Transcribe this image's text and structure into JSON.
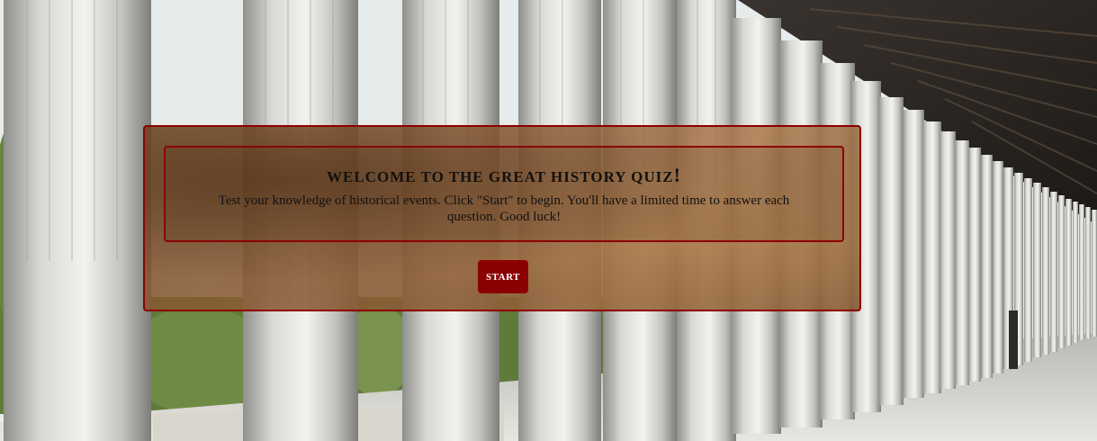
{
  "background": {
    "scene": "colonnade-photo",
    "accent_color": "#8b0000"
  },
  "quiz": {
    "title": "WELCOME TO THE GREAT HISTORY QUIZ",
    "title_bang": "!",
    "description": "Test your knowledge of historical events. Click \"Start\" to begin. You'll have a limited time to answer each question. Good luck!",
    "start_label": "START"
  }
}
